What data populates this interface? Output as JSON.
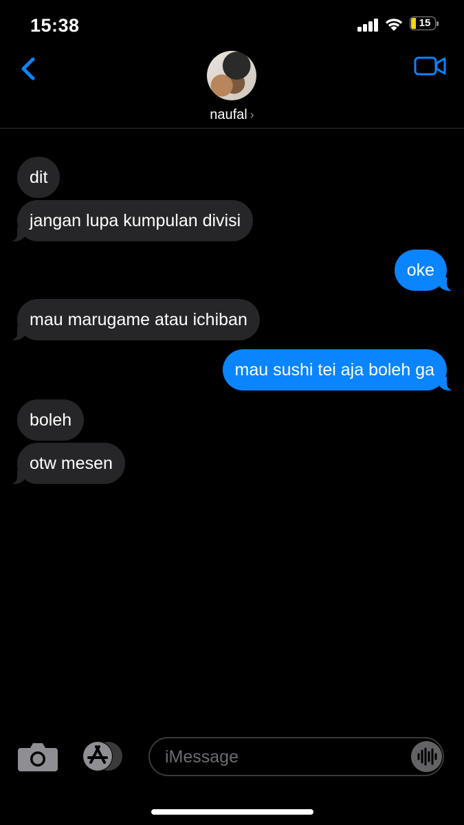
{
  "status_bar": {
    "time": "15:38",
    "battery_level": "15",
    "battery_color": "#ffd60a"
  },
  "header": {
    "contact_name": "naufal",
    "back_icon": "chevron-left-icon",
    "video_icon": "video-camera-icon",
    "accent_color": "#0a84ff"
  },
  "messages": [
    {
      "from": "contact",
      "text": "dit"
    },
    {
      "from": "contact",
      "text": "jangan lupa kumpulan divisi"
    },
    {
      "from": "me",
      "text": "oke"
    },
    {
      "from": "contact",
      "text": "mau marugame atau ichiban"
    },
    {
      "from": "me",
      "text": "mau sushi tei aja boleh ga"
    },
    {
      "from": "contact",
      "text": "boleh"
    },
    {
      "from": "contact",
      "text": "otw mesen"
    }
  ],
  "composer": {
    "placeholder": "iMessage",
    "camera_icon": "camera-icon",
    "apps_icon": "app-store-icon",
    "audio_icon": "audio-waveform-icon"
  }
}
